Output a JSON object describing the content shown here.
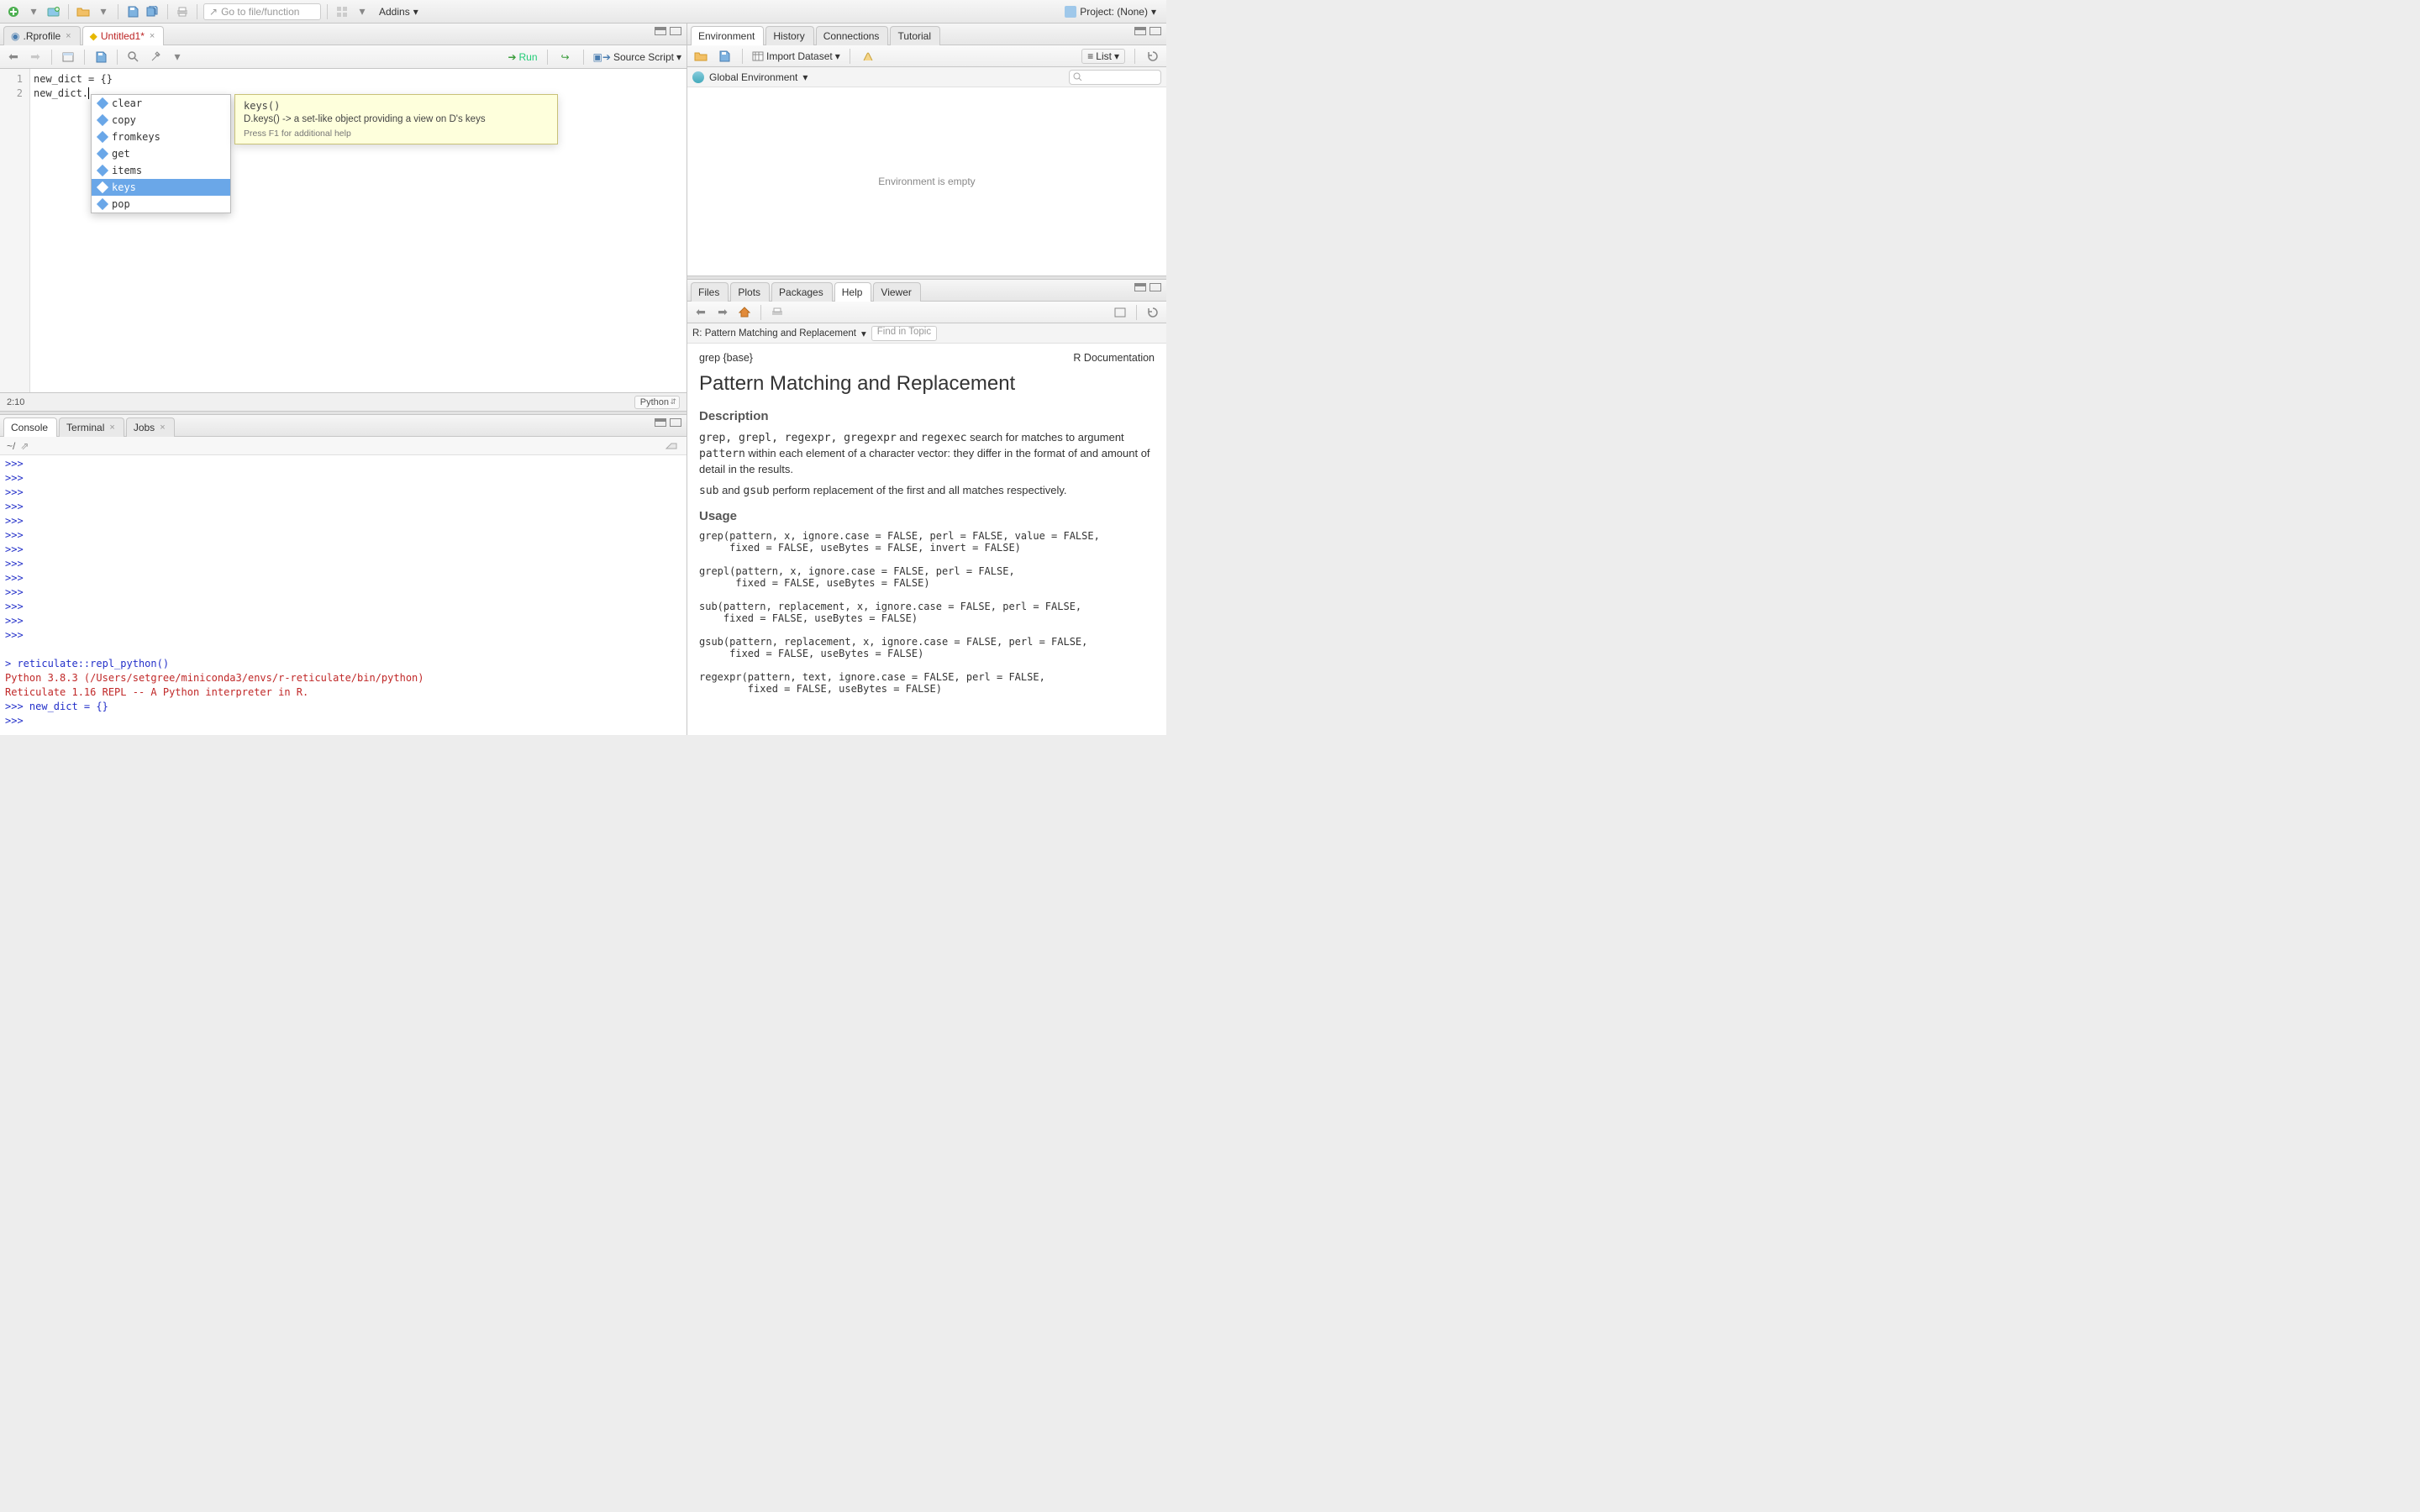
{
  "toolbar": {
    "goto_placeholder": "Go to file/function",
    "addins_label": "Addins",
    "project_label": "Project: (None)"
  },
  "source": {
    "tabs": [
      {
        "label": ".Rprofile",
        "modified": false,
        "icon": "r-file-icon"
      },
      {
        "label": "Untitled1",
        "modified": true,
        "icon": "python-file-icon"
      }
    ],
    "active_tab": 1,
    "run_label": "Run",
    "source_label": "Source Script",
    "gutter": [
      "1",
      "2"
    ],
    "lines": [
      "new_dict = {}",
      "new_dict."
    ],
    "cursor_pos": "2:10",
    "language": "Python"
  },
  "autocomplete": {
    "items": [
      "clear",
      "copy",
      "fromkeys",
      "get",
      "items",
      "keys",
      "pop"
    ],
    "selected_index": 5,
    "tooltip": {
      "signature": "keys()",
      "description": "D.keys() -> a set-like object providing a view on D's keys",
      "footer": "Press F1 for additional help"
    }
  },
  "console": {
    "tabs": [
      "Console",
      "Terminal",
      "Jobs"
    ],
    "active_tab": 0,
    "path": "~/",
    "lines": [
      {
        "cls": "prompt-py",
        "text": ">>> "
      },
      {
        "cls": "prompt-py",
        "text": ">>> "
      },
      {
        "cls": "prompt-py",
        "text": ">>> "
      },
      {
        "cls": "prompt-py",
        "text": ">>> "
      },
      {
        "cls": "prompt-py",
        "text": ">>> "
      },
      {
        "cls": "prompt-py",
        "text": ">>> "
      },
      {
        "cls": "prompt-py",
        "text": ">>> "
      },
      {
        "cls": "prompt-py",
        "text": ">>> "
      },
      {
        "cls": "prompt-py",
        "text": ">>> "
      },
      {
        "cls": "prompt-py",
        "text": ">>> "
      },
      {
        "cls": "prompt-py",
        "text": ">>> "
      },
      {
        "cls": "prompt-py",
        "text": ">>> "
      },
      {
        "cls": "prompt-py",
        "text": ">>> "
      },
      {
        "cls": "",
        "text": " "
      },
      {
        "cls": "prompt-r",
        "text": "> reticulate::repl_python()"
      },
      {
        "cls": "out-red",
        "text": "Python 3.8.3 (/Users/setgree/miniconda3/envs/r-reticulate/bin/python)"
      },
      {
        "cls": "out-red",
        "text": "Reticulate 1.16 REPL -- A Python interpreter in R."
      },
      {
        "cls": "prompt-py",
        "text": ">>> new_dict = {}"
      },
      {
        "cls": "prompt-py",
        "text": ">>> "
      }
    ]
  },
  "environment": {
    "tabs": [
      "Environment",
      "History",
      "Connections",
      "Tutorial"
    ],
    "active_tab": 0,
    "import_label": "Import Dataset",
    "view_mode": "List",
    "scope_label": "Global Environment",
    "empty_text": "Environment is empty"
  },
  "help": {
    "tabs": [
      "Files",
      "Plots",
      "Packages",
      "Help",
      "Viewer"
    ],
    "active_tab": 3,
    "breadcrumb": "R: Pattern Matching and Replacement",
    "find_placeholder": "Find in Topic",
    "head_left": "grep {base}",
    "head_right": "R Documentation",
    "title": "Pattern Matching and Replacement",
    "sections": {
      "desc_h": "Description",
      "desc_p1_pre": "grep, grepl, regexpr, gregexpr",
      "desc_p1_mid": " and ",
      "desc_p1_code2": "regexec",
      "desc_p1_rest": " search for matches to argument ",
      "desc_p1_code3": "pattern",
      "desc_p1_end": " within each element of a character vector: they differ in the format of and amount of detail in the results.",
      "desc_p2_code1": "sub",
      "desc_p2_mid": " and ",
      "desc_p2_code2": "gsub",
      "desc_p2_rest": " perform replacement of the first and all matches respectively.",
      "usage_h": "Usage",
      "usage_code": "grep(pattern, x, ignore.case = FALSE, perl = FALSE, value = FALSE,\n     fixed = FALSE, useBytes = FALSE, invert = FALSE)\n\ngrepl(pattern, x, ignore.case = FALSE, perl = FALSE,\n      fixed = FALSE, useBytes = FALSE)\n\nsub(pattern, replacement, x, ignore.case = FALSE, perl = FALSE,\n    fixed = FALSE, useBytes = FALSE)\n\ngsub(pattern, replacement, x, ignore.case = FALSE, perl = FALSE,\n     fixed = FALSE, useBytes = FALSE)\n\nregexpr(pattern, text, ignore.case = FALSE, perl = FALSE,\n        fixed = FALSE, useBytes = FALSE)"
    }
  }
}
